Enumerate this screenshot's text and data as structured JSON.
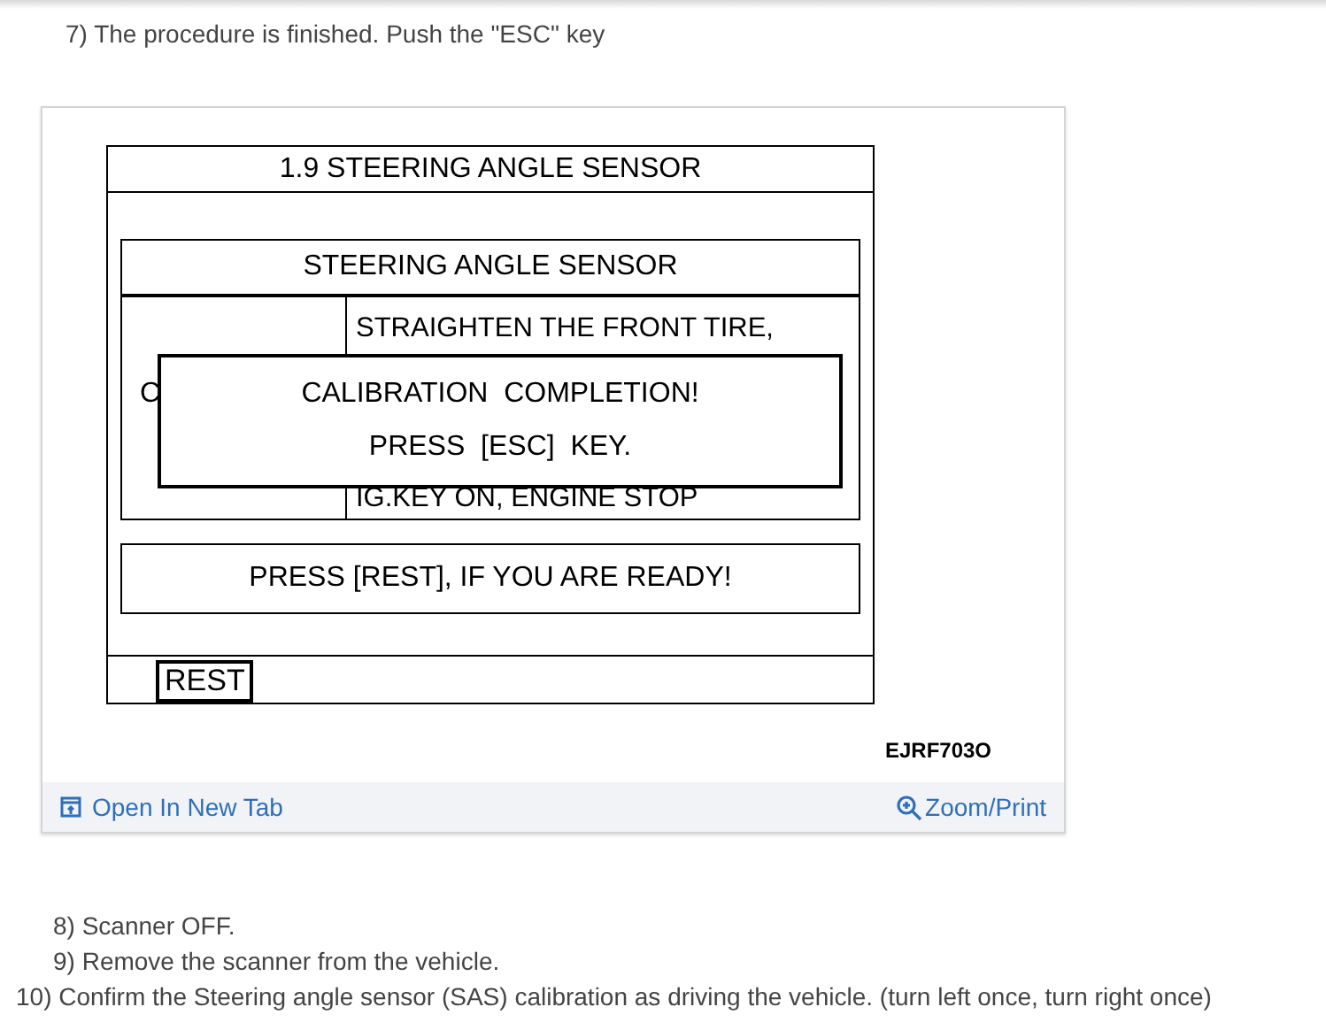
{
  "steps_before": [
    {
      "text": "7) The procedure is finished. Push the \"ESC\" key"
    }
  ],
  "figure": {
    "scanner_screen": {
      "title": "1.9 STEERING ANGLE SENSOR",
      "panel_header": "STEERING ANGLE SENSOR",
      "left_text": "C",
      "instructions": [
        "STRAIGHTEN THE FRONT TIRE,",
        "IG.KEY ON, ENGINE STOP"
      ],
      "popup": [
        "CALIBRATION  COMPLETION!",
        "PRESS  [ESC]  KEY."
      ],
      "prompt": "PRESS [REST], IF YOU ARE READY!",
      "key": "REST"
    },
    "code": "EJRF703O",
    "open_link": "Open In New Tab",
    "zoom_link": "Zoom/Print"
  },
  "steps_after": [
    {
      "text": "8) Scanner OFF."
    },
    {
      "text": "9) Remove the scanner from the vehicle."
    },
    {
      "text": "10) Confirm the Steering angle sensor (SAS) calibration as driving the vehicle. (turn left once, turn right once)"
    }
  ]
}
